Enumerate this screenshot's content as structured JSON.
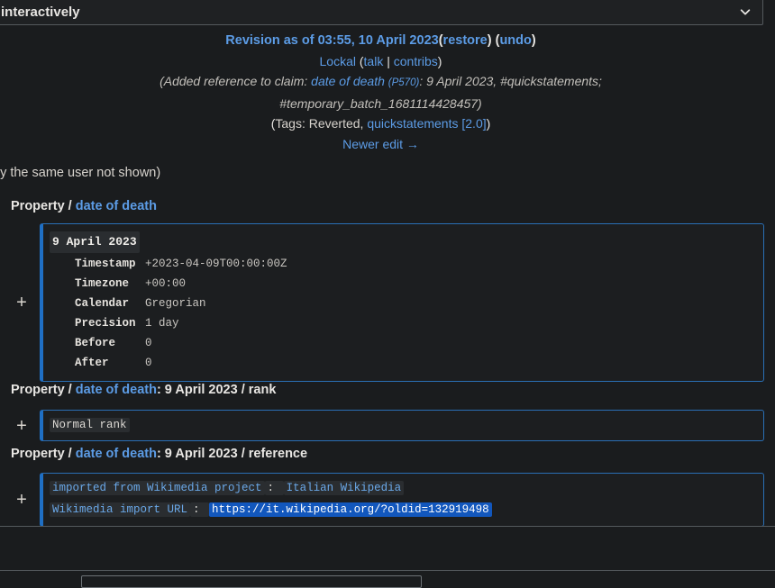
{
  "page": {
    "background_color": "#1a1c1e",
    "link_color": "#5c9ce6",
    "accent_color": "#1f6fc4",
    "selection_color": "#1257bd"
  },
  "dropdown": {
    "name": "diff-view-select",
    "selected_value": "interactively",
    "icon": "chevron-down-icon"
  },
  "revision": {
    "title_link": "Revision as of 03:55, 10 April 2023",
    "restore_open": "(",
    "restore_label": "restore",
    "restore_close": ")",
    "undo_open": "(",
    "undo_label": "undo",
    "undo_close": ")",
    "user": "Lockal",
    "user_paren_open": "(",
    "talk_label": "talk",
    "separator": "|",
    "contribs_label": "contribs",
    "user_paren_close": ")",
    "comment_prefix": "(Added reference to claim: ",
    "comment_property": "date of death",
    "comment_property_id": "(P570)",
    "comment_middle": ": 9 April 2023, #quickstatements;",
    "comment_batch": "#temporary_batch_1681114428457)",
    "tags_open": "(",
    "tags_label": "Tags",
    "tags_sep": ": ",
    "tags_reverted": "Reverted, ",
    "tags_link": "quickstatements [2.0]",
    "tags_close": ")",
    "newer_edit": "Newer edit →",
    "not_shown": "by the same user not shown)"
  },
  "diffs": [
    {
      "heading_prefix": "Property / ",
      "heading_link": "date of death",
      "heading_suffix": "",
      "marker": "+",
      "value_header": "9 April 2023",
      "fields": [
        {
          "key": "Timestamp",
          "value": "+2023-04-09T00:00:00Z"
        },
        {
          "key": "Timezone",
          "value": "+00:00"
        },
        {
          "key": "Calendar",
          "value": "Gregorian"
        },
        {
          "key": "Precision",
          "value": "1 day"
        },
        {
          "key": "Before",
          "value": "0"
        },
        {
          "key": "After",
          "value": "0"
        }
      ]
    },
    {
      "heading_prefix": "Property / ",
      "heading_link": "date of death",
      "heading_suffix": ": 9 April 2023 / rank",
      "marker": "+",
      "value_text": "Normal rank"
    },
    {
      "heading_prefix": "Property / ",
      "heading_link": "date of death",
      "heading_suffix": ": 9 April 2023 / reference",
      "marker": "+",
      "ref_line1_label": "imported from Wikimedia project",
      "ref_line1_sep": ": ",
      "ref_line1_value": "Italian Wikipedia",
      "ref_line2_label": "Wikimedia import URL",
      "ref_line2_sep": ": ",
      "ref_line2_value": "https://it.wikipedia.org/?oldid=132919498"
    }
  ]
}
